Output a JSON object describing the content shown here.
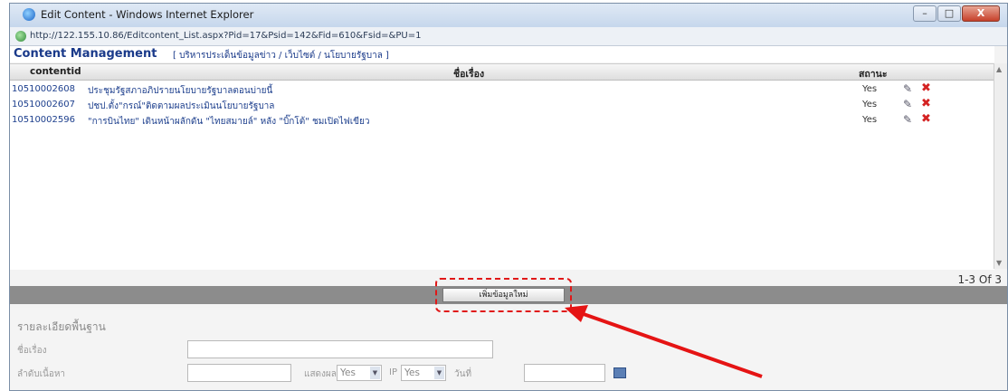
{
  "window": {
    "title": "Edit Content - Windows Internet Explorer",
    "url": "http://122.155.10.86/Editcontent_List.aspx?Pid=17&Psid=142&Fid=610&Fsid=&PU=1",
    "buttons": {
      "minimize": "–",
      "maximize": "□",
      "close": "X"
    }
  },
  "header": {
    "title": "Content Management",
    "breadcrumb": "[ บริหารประเด็นข้อมูลข่าว / เว็บไซต์ / นโยบายรัฐบาล ]"
  },
  "grid": {
    "columns": {
      "id": "contentid",
      "title": "ชื่อเรื่อง",
      "status": "สถานะ"
    },
    "rows": [
      {
        "id": "10510002608",
        "title": "ประชุมรัฐสภาอภิปรายนโยบายรัฐบาลตอนบ่ายนี้",
        "status": "Yes"
      },
      {
        "id": "10510002607",
        "title": "ปชป.ตั้ง\"กรณ์\"ติดตามผลประเมินนโยบายรัฐบาล",
        "status": "Yes"
      },
      {
        "id": "10510002596",
        "title": "\"การบินไทย\" เดินหน้าผลักดัน \"ไทยสมายล์\" หลัง \"บิ๊กโต้\" ชมเปิดไฟเขียว",
        "status": "Yes"
      }
    ]
  },
  "pager": {
    "text": "1-3 Of 3"
  },
  "actions": {
    "add_label": "เพิ่มข้อมูลใหม่"
  },
  "details": {
    "section_title": "รายละเอียดพื้นฐาน",
    "subject_label": "ชื่อเรื่อง",
    "order_label": "ลำดับเนื้อหา",
    "show_label": "แสดงผล",
    "show_value": "Yes",
    "ip_label": "IP",
    "ip_value": "Yes",
    "date_label": "วันที่"
  },
  "colors": {
    "accent": "#1a3a8a",
    "highlight": "#e01818",
    "delete": "#d42222"
  }
}
